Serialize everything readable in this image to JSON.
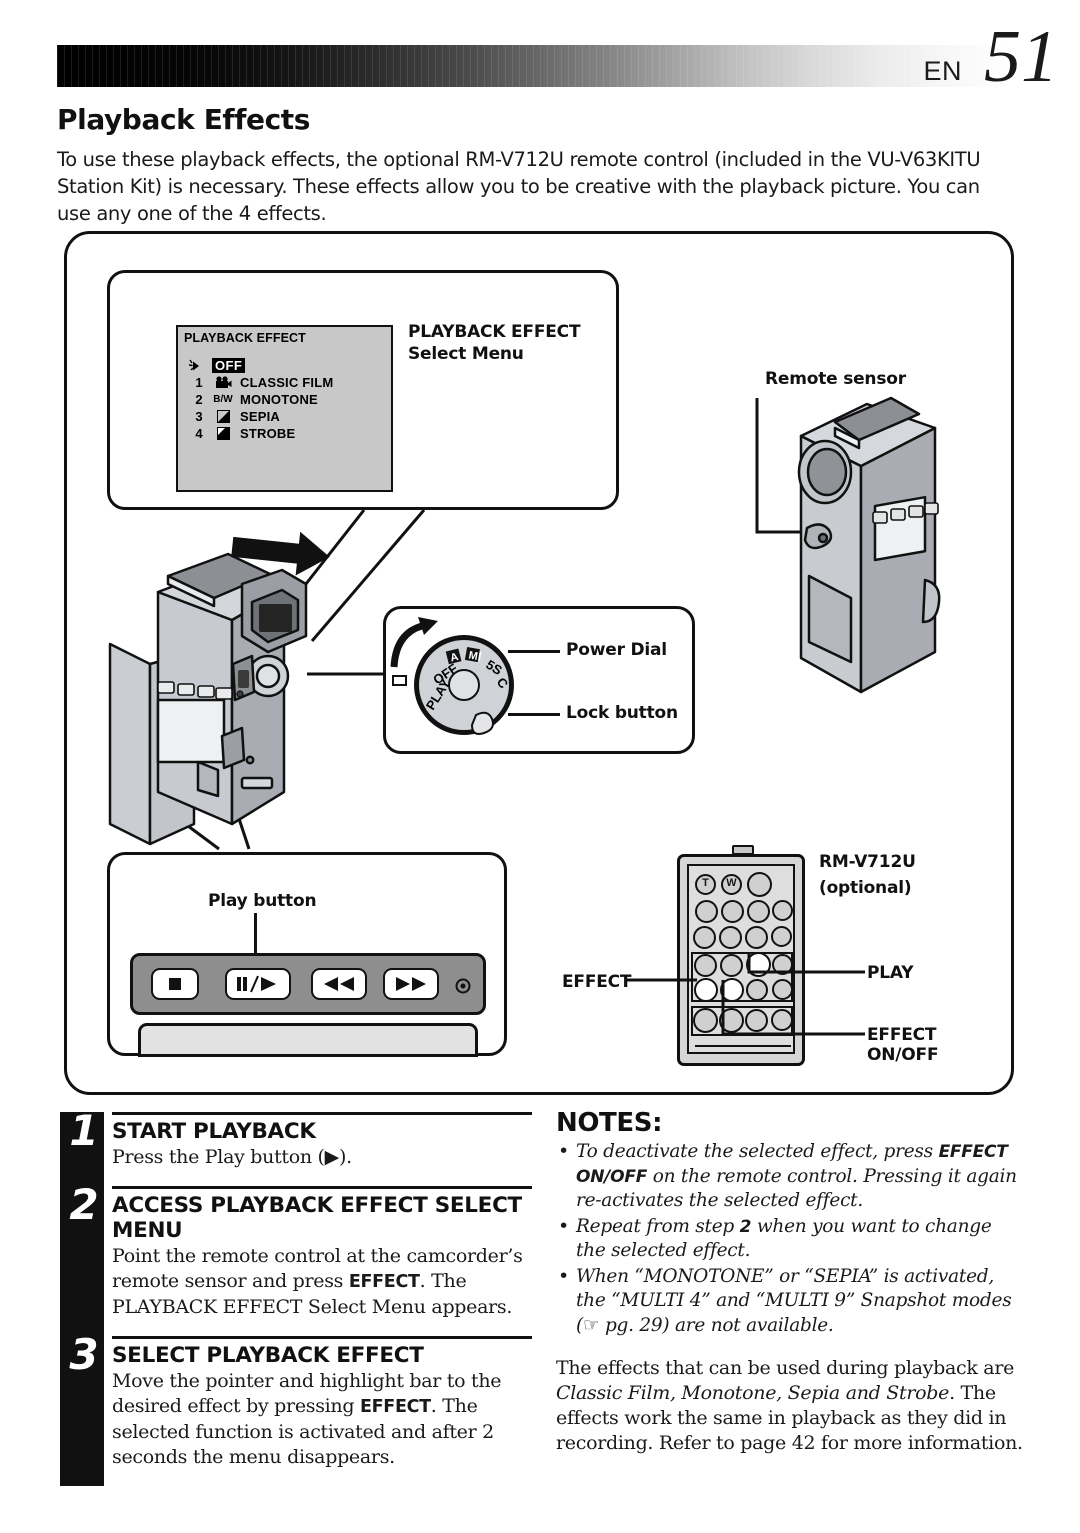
{
  "header": {
    "en_label": "EN",
    "page_number": "51"
  },
  "page_title": "Playback Effects",
  "intro": "To use these playback effects, the optional RM-V712U remote control (included in the VU-V63KITU Station Kit) is necessary. These effects allow you to be creative with the playback picture. You can use any one of the 4 effects.",
  "figure": {
    "osd": {
      "title": "PLAYBACK EFFECT",
      "off_label": "OFF",
      "items": [
        {
          "num": "1",
          "icon": "movie-camera-icon",
          "icon_text": "",
          "label": "CLASSIC FILM"
        },
        {
          "num": "2",
          "icon": "bw-icon",
          "icon_text": "B/W",
          "label": "MONOTONE"
        },
        {
          "num": "3",
          "icon": "sepia-icon",
          "icon_text": "",
          "label": "SEPIA"
        },
        {
          "num": "4",
          "icon": "strobe-icon",
          "icon_text": "",
          "label": "STROBE"
        }
      ]
    },
    "osd_caption": "PLAYBACK EFFECT Select Menu",
    "remote_sensor_label": "Remote sensor",
    "power_dial_label": "Power Dial",
    "lock_button_label": "Lock button",
    "dial_positions": [
      "PLAY",
      "OFF",
      "A",
      "M",
      "5S",
      "C"
    ],
    "play_button_label": "Play button",
    "transport_buttons": [
      "stop-icon",
      "pause-play-icon",
      "rewind-icon",
      "fast-forward-icon",
      "record-indicator-icon"
    ],
    "remote": {
      "model_label": "RM-V712U",
      "optional_label": "(optional)",
      "effect_label": "EFFECT",
      "play_label": "PLAY",
      "effect_onoff_label": "EFFECT ON/OFF",
      "zoom_tele": "T",
      "zoom_wide": "W"
    }
  },
  "steps": [
    {
      "number": "1",
      "heading": "START PLAYBACK",
      "body_pre": "Press the Play button (",
      "body_icon": "▶",
      "body_post": ")."
    },
    {
      "number": "2",
      "heading": "ACCESS PLAYBACK EFFECT SELECT MENU",
      "body_1": "Point the remote control at the camcorder’s remote sensor and press ",
      "body_b1": "EFFECT",
      "body_2": ". The PLAYBACK EFFECT Select Menu appears."
    },
    {
      "number": "3",
      "heading": "SELECT PLAYBACK EFFECT",
      "body_1": "Move the pointer and highlight bar to the desired effect by pressing ",
      "body_b1": "EFFECT",
      "body_2": ". The selected function is activated and after 2 seconds the menu disappears."
    }
  ],
  "notes": {
    "title": "NOTES:",
    "items": [
      {
        "t1": "To deactivate the selected effect, press ",
        "b1": "EFFECT ON/OFF",
        "t2": " on the remote control. Pressing it again re-activates the selected effect."
      },
      {
        "t1": "Repeat from step ",
        "b1": "2",
        "t2": " when you want to change the selected effect."
      },
      {
        "t1": "When “MONOTONE” or “SEPIA” is activated, the “MULTI 4” and “MULTI 9” Snapshot modes (",
        "b1": "☞",
        "t2": " pg. 29) are not available."
      }
    ],
    "paragraph_1": "The effects that can be used during playback are ",
    "paragraph_italic": "Classic Film, Monotone, Sepia and Strobe",
    "paragraph_2": ". The effects work the same in playback as they did in recording. Refer to page 42 for more information."
  }
}
